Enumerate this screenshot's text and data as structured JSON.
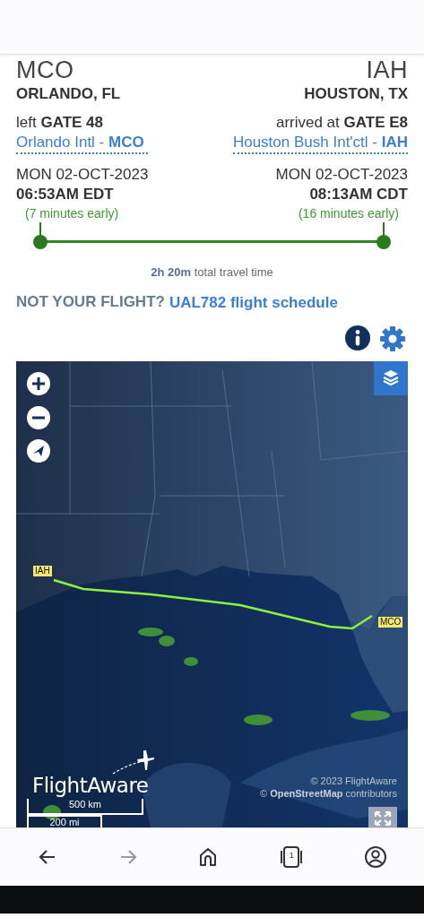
{
  "flight": {
    "origin": {
      "code": "MCO",
      "city": "ORLANDO, FL",
      "gate_prefix": "left",
      "gate": "GATE 48",
      "airport_link": "Orlando Intl - **MCO**",
      "date": "MON 02-OCT-2023",
      "time": "06:53AM EDT",
      "status": "(7 minutes early)"
    },
    "destination": {
      "code": "IAH",
      "city": "HOUSTON, TX",
      "gate_prefix": "arrived at",
      "gate": "GATE E8",
      "airport_link": "Houston Bush Int'ctl - **IAH**",
      "date": "MON 02-OCT-2023",
      "time": "08:13AM CDT",
      "status": "(16 minutes early)"
    },
    "progress": {
      "level": 1
    },
    "travel_time": "**2h 20m** total travel time"
  },
  "not_your_flight": {
    "prompt": "NOT YOUR FLIGHT?",
    "link": "UAL782 flight schedule"
  },
  "map": {
    "kind": "picture",
    "airport_labels": [
      "IAH",
      "MCO"
    ],
    "logo": "FlightAware",
    "attribution": [
      "© 2023 FlightAware",
      "© **OpenStreetMap** contributors"
    ],
    "scale": [
      "500 km",
      "200 mi"
    ]
  },
  "nav_bar": [
    {
      "kind": "back",
      "disabled": false
    },
    {
      "kind": "forward",
      "disabled": true
    },
    {
      "kind": "home",
      "disabled": false
    },
    {
      "kind": "tabs",
      "disabled": false,
      "count": "1"
    },
    {
      "kind": "account",
      "disabled": false
    }
  ]
}
